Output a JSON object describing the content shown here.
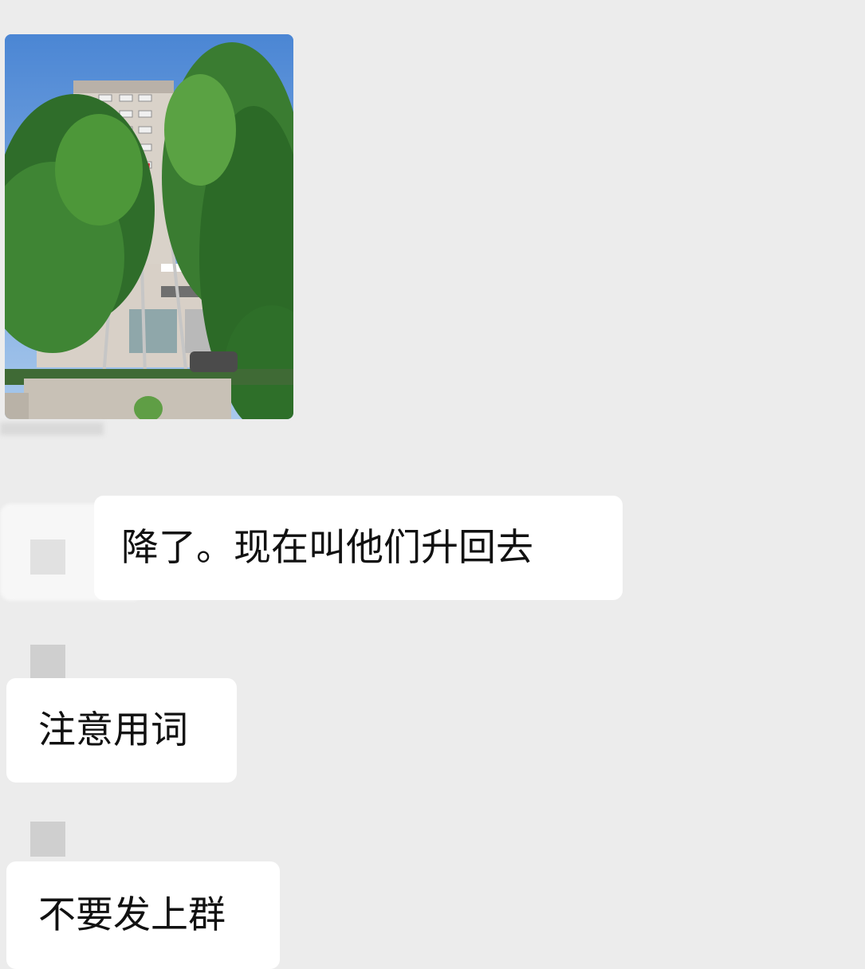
{
  "conversation": {
    "image_message": {
      "alt": ""
    },
    "messages": [
      {
        "text": "降了。现在叫他们升回去"
      },
      {
        "text": "注意用词"
      },
      {
        "text": "不要发上群"
      }
    ]
  },
  "colors": {
    "background": "#ececec",
    "bubble": "#ffffff",
    "text": "#111111",
    "avatar_placeholder": "#cfcfcf"
  }
}
